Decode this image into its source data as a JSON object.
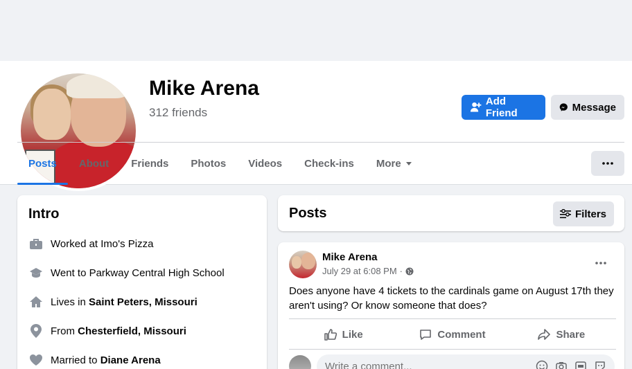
{
  "profile": {
    "name": "Mike Arena",
    "friends_count": "312 friends",
    "add_friend_label": "Add Friend",
    "message_label": "Message"
  },
  "tabs": [
    {
      "label": "Posts"
    },
    {
      "label": "About"
    },
    {
      "label": "Friends"
    },
    {
      "label": "Photos"
    },
    {
      "label": "Videos"
    },
    {
      "label": "Check-ins"
    },
    {
      "label": "More"
    }
  ],
  "intro": {
    "title": "Intro",
    "items": [
      {
        "icon": "briefcase-icon",
        "prefix": "Worked at Imo's Pizza",
        "bold": ""
      },
      {
        "icon": "graduation-cap-icon",
        "prefix": "Went to Parkway Central High School",
        "bold": ""
      },
      {
        "icon": "home-icon",
        "prefix": "Lives in ",
        "bold": "Saint Peters, Missouri"
      },
      {
        "icon": "location-pin-icon",
        "prefix": "From ",
        "bold": "Chesterfield, Missouri"
      },
      {
        "icon": "heart-icon",
        "prefix": "Married to ",
        "bold": "Diane Arena"
      }
    ]
  },
  "posts_header": {
    "title": "Posts",
    "filters_label": "Filters"
  },
  "post": {
    "author": "Mike Arena",
    "timestamp": "July 29 at 6:08 PM",
    "separator": "·",
    "text": "Does anyone have 4 tickets to the cardinals game on August 17th they aren't using? Or know someone that does?",
    "like_label": "Like",
    "comment_label": "Comment",
    "share_label": "Share",
    "comment_placeholder": "Write a comment..."
  },
  "colors": {
    "accent": "#1b74e4",
    "secondary_button": "#e4e6eb",
    "background": "#f0f2f5",
    "muted_text": "#65676b"
  }
}
